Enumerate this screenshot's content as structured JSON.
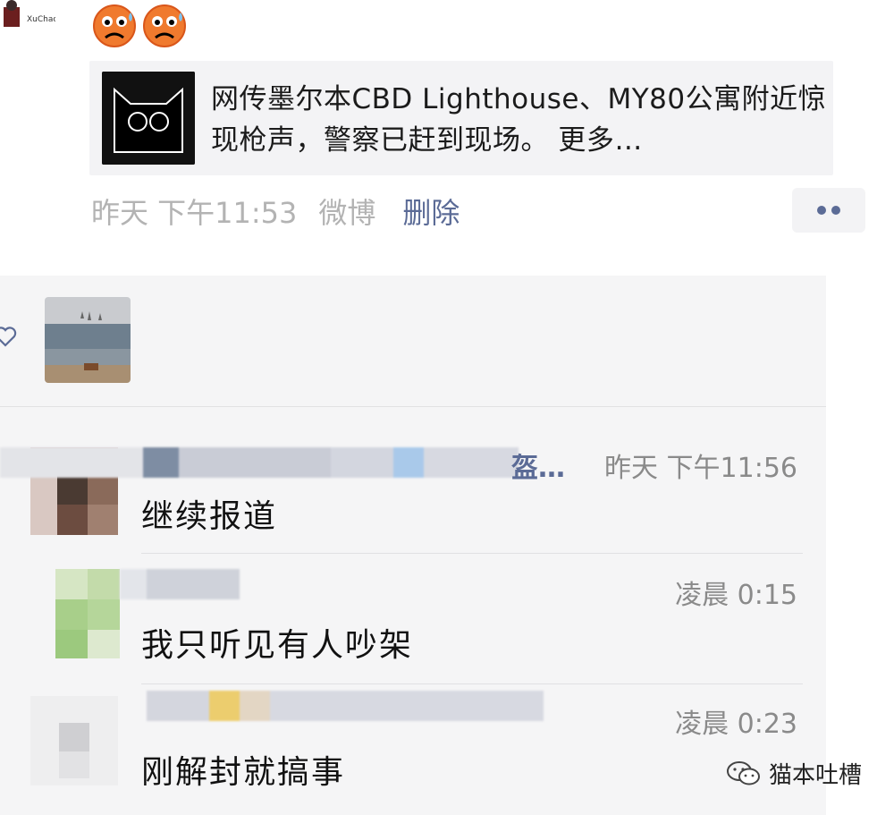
{
  "post": {
    "author_avatar_label": "XuChao",
    "link": {
      "title": "网传墨尔本CBD Lighthouse、MY80公寓附近惊现枪声，警察已赶到现场。 更多…"
    },
    "time": "昨天 下午11:53",
    "source": "微博",
    "delete_label": "删除"
  },
  "comments": [
    {
      "time": "昨天 下午11:56",
      "text": "继续报道",
      "name_truncated": "盔…"
    },
    {
      "time": "凌晨 0:15",
      "text": "我只听见有人吵架"
    },
    {
      "time": "凌晨 0:23",
      "text": "刚解封就搞事"
    }
  ],
  "watermark": {
    "text": "猫本吐槽"
  },
  "icons": {
    "emoji": "sweat-frown-emoji",
    "heart": "heart-outline-icon",
    "more": "more-dots-icon",
    "watermark": "wechat-icon"
  },
  "colors": {
    "link_blue": "#5b6b96",
    "meta_gray": "#b3b3b3",
    "panel_bg": "#f5f5f6"
  }
}
